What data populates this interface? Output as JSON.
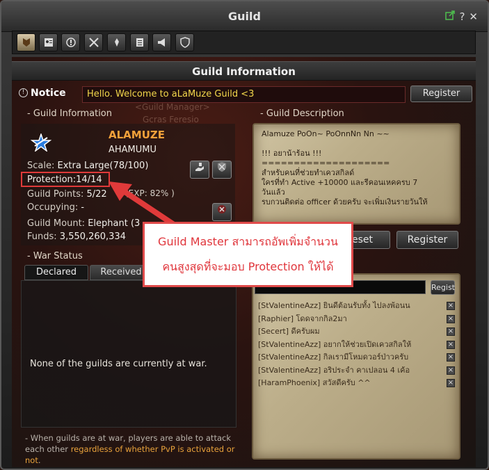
{
  "window": {
    "title": "Guild",
    "icons": [
      "popout-icon",
      "help-icon",
      "close-icon"
    ],
    "help_glyph": "?",
    "close_glyph": "✕"
  },
  "toolbar": {
    "tabs": [
      "guild-icon",
      "member-icon",
      "notice-icon",
      "war-icon",
      "rank-icon",
      "log-icon",
      "announce-icon",
      "shield-icon"
    ]
  },
  "header": {
    "title": "Guild Information"
  },
  "notice": {
    "label": "Notice",
    "text": "Hello. Welcome to aLaMuze Guild <3",
    "register_label": "Register"
  },
  "guild_info": {
    "section_title": "- Guild Information",
    "ghost_text_1": "<Guild Manager>",
    "ghost_text_2": "Gcras Feresio",
    "name": "ALAMUZE",
    "subtitle": "AHAMUMU",
    "scale_label": "Scale:",
    "scale_value": "Extra Large(78/100)",
    "protection_label": "Protection:",
    "protection_value": "14/14",
    "points_label": "Guild Points:",
    "points_value": "5/22",
    "exp_value": "(EXP: 82% )",
    "occupying_label": "Occupying:",
    "occupying_value": "-",
    "mount_label": "Guild Mount:",
    "mount_value": "Elephant (3",
    "funds_label": "Funds:",
    "funds_value": "3,550,260,334"
  },
  "war_status": {
    "section_title": "- War Status",
    "tab_declared": "Declared",
    "tab_received": "Received",
    "empty_text": "None of the guilds are currently at war.",
    "footer_a": "- When guilds are at war, players are able to attack each other ",
    "footer_b": "regardless of whether PvP is activated or not",
    "footer_c": "."
  },
  "guild_description": {
    "section_title": "- Guild Description",
    "text": "Alamuze PoOn~ PoOnnNn Nn ~~\n\n!!! อยาน้าร้อน !!!\n====================\nสำหรับคนที่ช่วยทำเควสกิลด์\nใครที่ทำ Active +10000 และรีคอนเหคครบ 7\nวันแล้ว\nรบกวนติดต่อ officer ด้วยครับ จะเพิ่มเงินรายวันให้",
    "reset_label": "eset",
    "register_label": "Register"
  },
  "chat": {
    "regist_label": "Regist",
    "messages": [
      "[StValentineAzz] ยินดีต้อนรับทั้ง ไปลงพ้อนน",
      "[Raphier] โดดจากกิล2มา",
      "[Secert] ดีครับผม",
      "[StValentineAzz] อยากให้ช่วยเปิดเควสกิลให้",
      "[StValentineAzz] กิลเรามีโหมดวอร์ป่าวครับ",
      "[StValentineAzz] อริประจำ คาเปลอน 4 เค้อ",
      "[HaramPhoenix] สวัสดีครับ ^^"
    ]
  },
  "callout": {
    "line1": "Guild Master สามารถอัพเพิ่มจำนวน",
    "line2": "คนสูงสุดที่จะมอบ Protection ให้ได้"
  },
  "colors": {
    "accent_orange": "#f2a13a",
    "notice_yellow": "#f2d64b",
    "callout_red": "#e0363c"
  }
}
